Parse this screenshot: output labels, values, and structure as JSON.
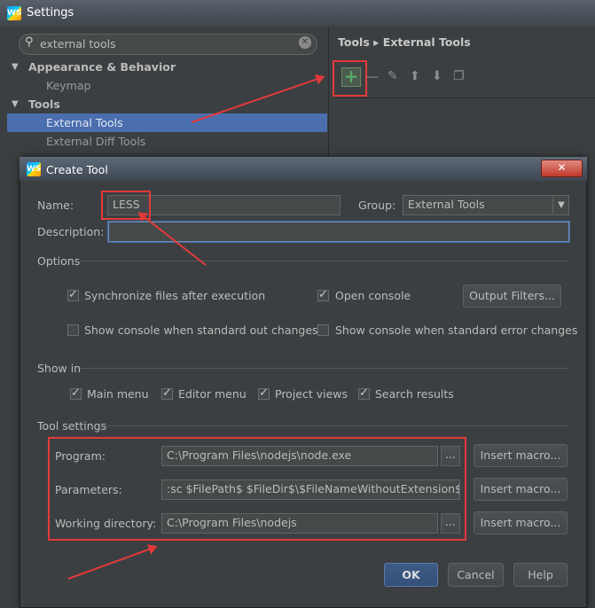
{
  "settings": {
    "title": "Settings",
    "search": {
      "value": "external tools"
    },
    "tree": {
      "appearance": "Appearance & Behavior",
      "keymap": "Keymap",
      "tools": "Tools",
      "external_tools": "External Tools",
      "external_diff_tools": "External Diff Tools"
    },
    "breadcrumb": {
      "parent": "Tools",
      "separator": "▸",
      "current": "External Tools"
    },
    "toolbar": {
      "add": "+",
      "remove": "—",
      "edit": "✎",
      "up": "⬆",
      "down": "⬇",
      "copy": "❐"
    }
  },
  "dialog": {
    "title": "Create Tool",
    "close": "✕",
    "name_label": "Name:",
    "name_value": "LESS",
    "group_label": "Group:",
    "group_value": "External Tools",
    "description_label": "Description:",
    "description_value": "",
    "options_header": "Options",
    "sync_files": "Synchronize files after execution",
    "open_console": "Open console",
    "output_filters": "Output Filters...",
    "show_console_stdout": "Show console when standard out changes",
    "show_console_stderr": "Show console when standard error changes",
    "show_in_header": "Show in",
    "main_menu": "Main menu",
    "editor_menu": "Editor menu",
    "project_views": "Project views",
    "search_results": "Search results",
    "tool_settings_header": "Tool settings",
    "program_label": "Program:",
    "program_value": "C:\\Program Files\\nodejs\\node.exe",
    "parameters_label": "Parameters:",
    "parameters_value": ":sc $FilePath$ $FileDir$\\$FileNameWithoutExtension$.css",
    "working_dir_label": "Working directory:",
    "working_dir_value": "C:\\Program Files\\nodejs",
    "browse": "...",
    "insert_macro": "Insert macro...",
    "ok": "OK",
    "cancel": "Cancel",
    "help": "Help"
  },
  "colors": {
    "selection": "#4b6eaf",
    "annotation": "#e33a3a",
    "add_icon": "#59a869"
  }
}
